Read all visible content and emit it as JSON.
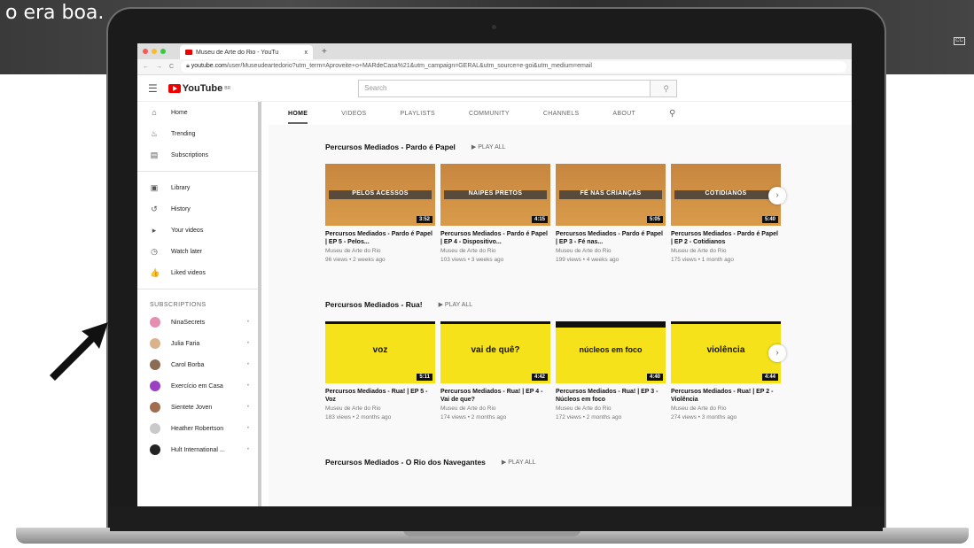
{
  "caption": "o era boa.",
  "browser": {
    "tab_title": "Museu de Arte do Rio - YouTu",
    "tab_close": "x",
    "new_tab": "+",
    "url_host": "youtube.com",
    "url_path": "/user/Museudeartedorio?utm_term=Aproveite+o+MARdeCasa%21&utm_campaign=GERAL&utm_source=e-goi&utm_medium=email"
  },
  "youtube": {
    "logo": "YouTube",
    "logo_sup": "BR",
    "search_placeholder": "Search"
  },
  "sidebar": {
    "primary": [
      {
        "label": "Home",
        "icon": "home-icon",
        "glyph": "⌂"
      },
      {
        "label": "Trending",
        "icon": "flame-icon",
        "glyph": "♨"
      },
      {
        "label": "Subscriptions",
        "icon": "subscriptions-icon",
        "glyph": "▤"
      }
    ],
    "library": [
      {
        "label": "Library",
        "icon": "library-icon",
        "glyph": "▣"
      },
      {
        "label": "History",
        "icon": "history-icon",
        "glyph": "↺"
      },
      {
        "label": "Your videos",
        "icon": "your-videos-icon",
        "glyph": "▸"
      },
      {
        "label": "Watch later",
        "icon": "clock-icon",
        "glyph": "◷"
      },
      {
        "label": "Liked videos",
        "icon": "thumbs-up-icon",
        "glyph": "👍"
      }
    ],
    "subs_heading": "SUBSCRIPTIONS",
    "subscriptions": [
      {
        "label": "NinaSecrets",
        "color": "#e58fb0"
      },
      {
        "label": "Julia Faria",
        "color": "#d9b38c"
      },
      {
        "label": "Carol Borba",
        "color": "#8c6b55"
      },
      {
        "label": "Exercício em Casa",
        "color": "#9b3fc5"
      },
      {
        "label": "Sientete Joven",
        "color": "#a06d50"
      },
      {
        "label": "Heather Robertson",
        "color": "#c9c9c9"
      },
      {
        "label": "Hult International ...",
        "color": "#222222"
      }
    ]
  },
  "channel_tabs": [
    "HOME",
    "VIDEOS",
    "PLAYLISTS",
    "COMMUNITY",
    "CHANNELS",
    "ABOUT"
  ],
  "shelves": [
    {
      "title": "Percursos Mediados - Pardo é Papel",
      "play_all": "PLAY ALL",
      "videos": [
        {
          "thumb_text": "PELOS ACESSOS",
          "duration": "3:52",
          "title": "Percursos Mediados - Pardo é Papel | EP 5 - Pelos...",
          "channel": "Museu de Arte do Rio",
          "meta": "96 views • 2 weeks ago"
        },
        {
          "thumb_text": "NAIPES PRETOS",
          "duration": "4:15",
          "title": "Percursos Mediados - Pardo é Papel | EP 4 - Dispositivo...",
          "channel": "Museu de Arte do Rio",
          "meta": "103 views • 3 weeks ago"
        },
        {
          "thumb_text": "FÉ NAS CRIANÇAS",
          "duration": "5:05",
          "title": "Percursos Mediados - Pardo é Papel | EP 3 - Fé nas...",
          "channel": "Museu de Arte do Rio",
          "meta": "199 views • 4 weeks ago"
        },
        {
          "thumb_text": "COTIDIANOS",
          "duration": "5:40",
          "title": "Percursos Mediados - Pardo é Papel | EP 2 - Cotidianos",
          "channel": "Museu de Arte do Rio",
          "meta": "175 views • 1 month ago"
        }
      ]
    },
    {
      "title": "Percursos Mediados - Rua!",
      "play_all": "PLAY ALL",
      "videos": [
        {
          "thumb_text": "voz",
          "duration": "5:11",
          "title": "Percursos Mediados - Rua! | EP 5 - Voz",
          "channel": "Museu de Arte do Rio",
          "meta": "183 views • 2 months ago"
        },
        {
          "thumb_text": "vai de quê?",
          "duration": "4:42",
          "title": "Percursos Mediados - Rua! | EP 4 - Vai de que?",
          "channel": "Museu de Arte do Rio",
          "meta": "174 views • 2 months ago"
        },
        {
          "thumb_text": "núcleos em foco",
          "duration": "4:40",
          "title": "Percursos Mediados - Rua! | EP 3 - Núcleos em foco",
          "channel": "Museu de Arte do Rio",
          "meta": "172 views • 2 months ago"
        },
        {
          "thumb_text": "violência",
          "duration": "4:44",
          "title": "Percursos Mediados - Rua! | EP 2 - Violência",
          "channel": "Museu de Arte do Rio",
          "meta": "274 views • 3 months ago"
        }
      ]
    },
    {
      "title": "Percursos Mediados - O Rio dos Navegantes",
      "play_all": "PLAY ALL"
    }
  ]
}
